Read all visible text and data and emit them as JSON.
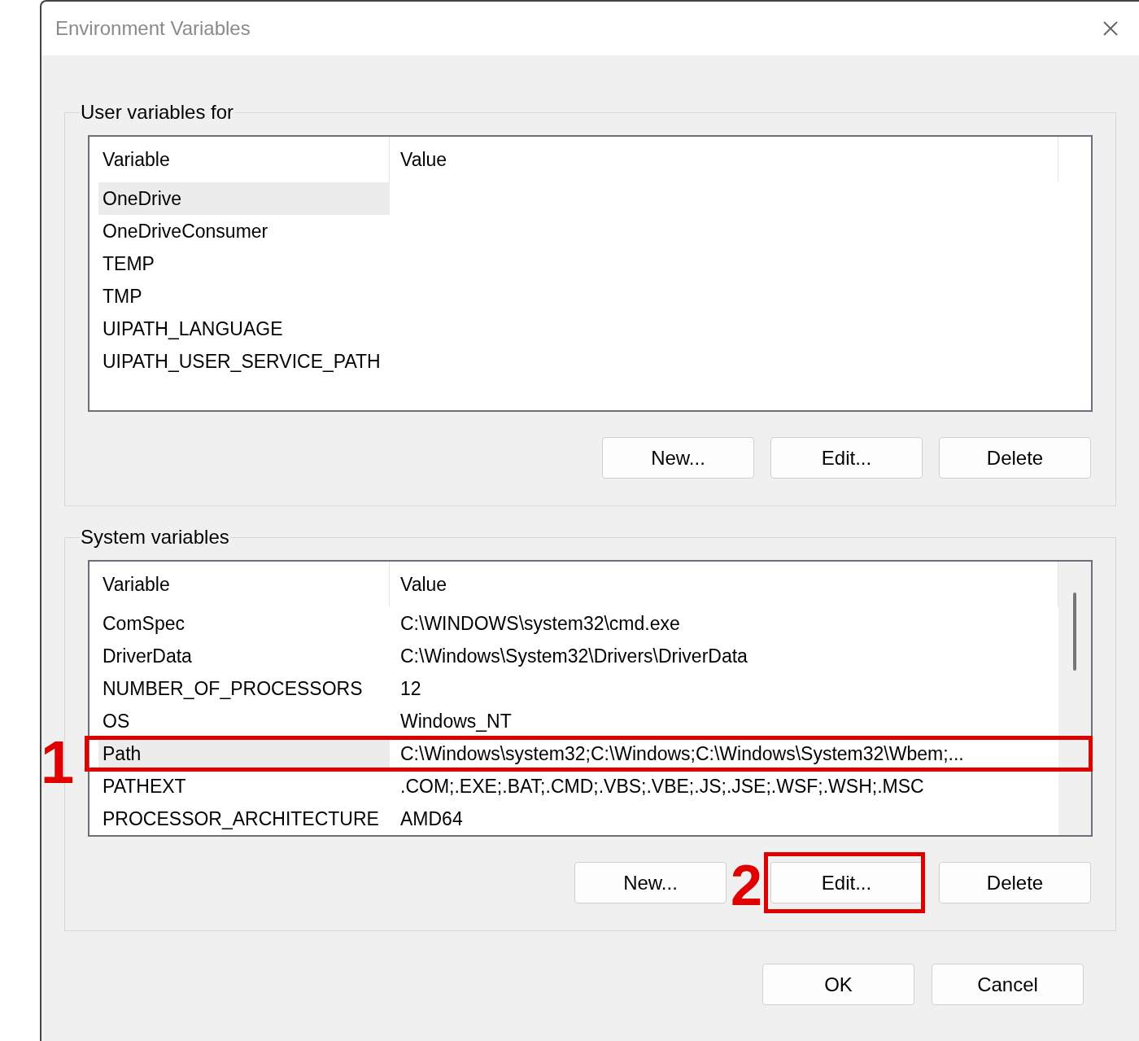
{
  "window": {
    "title": "Environment Variables"
  },
  "user_variables": {
    "label": "User variables for",
    "columns": [
      "Variable",
      "Value"
    ],
    "rows": [
      {
        "variable": "OneDrive",
        "selected": true,
        "highlighted": false
      },
      {
        "variable": "OneDriveConsumer",
        "selected": false,
        "highlighted": false
      },
      {
        "variable": "TEMP",
        "selected": false,
        "highlighted": false
      },
      {
        "variable": "TMP",
        "selected": false,
        "highlighted": false
      },
      {
        "variable": "UIPATH_LANGUAGE",
        "selected": false,
        "highlighted": false
      },
      {
        "variable": "UIPATH_USER_SERVICE_PATH",
        "selected": false,
        "highlighted": false
      }
    ],
    "buttons": [
      {
        "label": "New...",
        "highlighted": false
      },
      {
        "label": "Edit...",
        "highlighted": false
      },
      {
        "label": "Delete",
        "highlighted": false
      }
    ]
  },
  "system_variables": {
    "label": "System variables",
    "columns": [
      "Variable",
      "Value"
    ],
    "rows": [
      {
        "variable": "ComSpec",
        "value": "C:\\WINDOWS\\system32\\cmd.exe",
        "selected": false,
        "highlighted": false
      },
      {
        "variable": "DriverData",
        "value": "C:\\Windows\\System32\\Drivers\\DriverData",
        "selected": false,
        "highlighted": false
      },
      {
        "variable": "NUMBER_OF_PROCESSORS",
        "value": "12",
        "selected": false,
        "highlighted": false
      },
      {
        "variable": "OS",
        "value": "Windows_NT",
        "selected": false,
        "highlighted": false
      },
      {
        "variable": "Path",
        "value": "C:\\Windows\\system32;C:\\Windows;C:\\Windows\\System32\\Wbem;...",
        "selected": true,
        "highlighted": true,
        "callout": "1"
      },
      {
        "variable": "PATHEXT",
        "value": ".COM;.EXE;.BAT;.CMD;.VBS;.VBE;.JS;.JSE;.WSF;.WSH;.MSC",
        "selected": false,
        "highlighted": false
      },
      {
        "variable": "PROCESSOR_ARCHITECTURE",
        "value": "AMD64",
        "selected": false,
        "highlighted": false
      }
    ],
    "buttons": [
      {
        "label": "New...",
        "highlighted": false
      },
      {
        "label": "Edit...",
        "highlighted": true,
        "callout": "2"
      },
      {
        "label": "Delete",
        "highlighted": false
      }
    ]
  },
  "dialog_buttons": [
    "OK",
    "Cancel"
  ]
}
